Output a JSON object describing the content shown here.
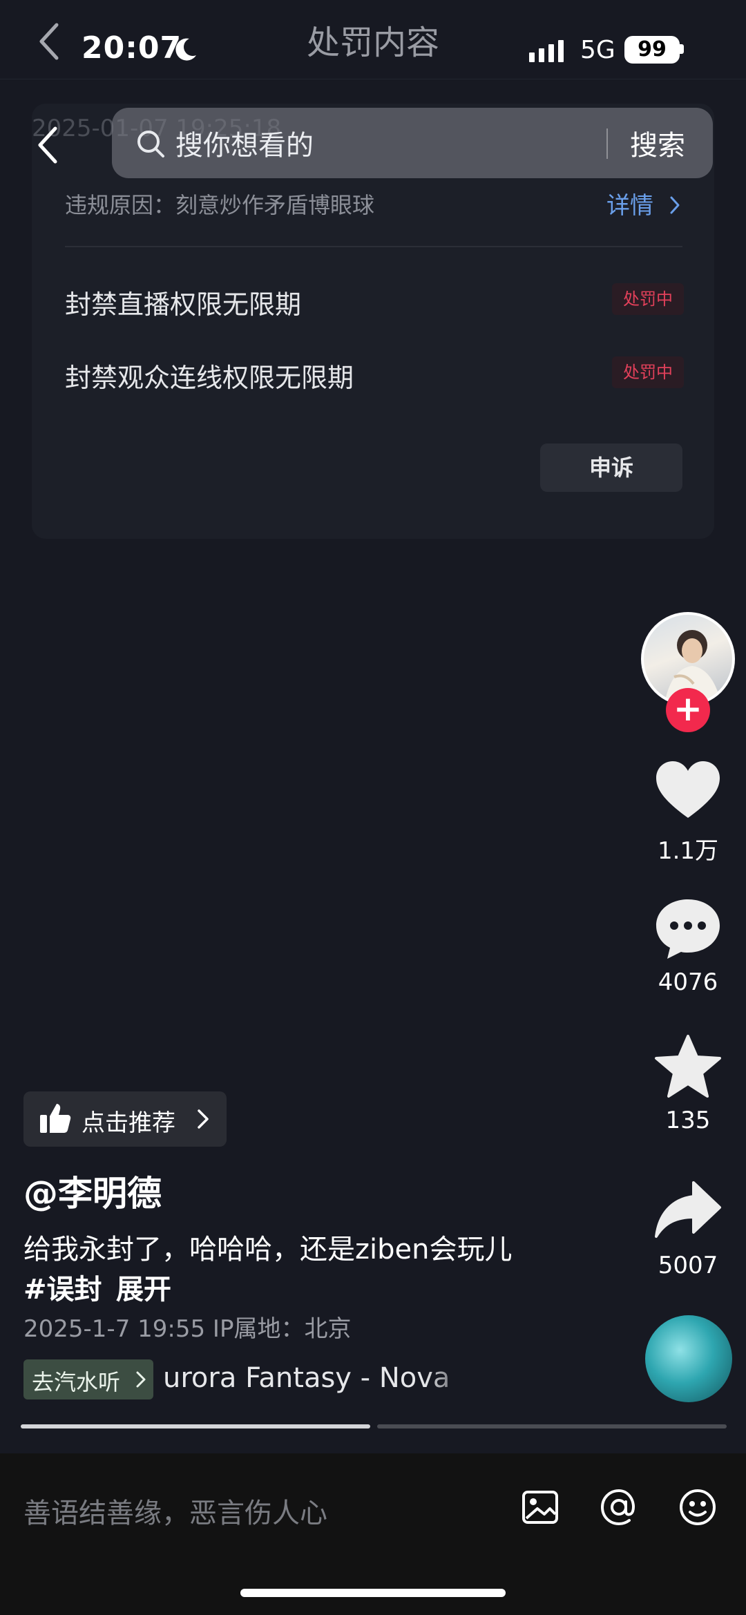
{
  "status": {
    "time": "20:07",
    "network": "5G",
    "battery": "99"
  },
  "header": {
    "title": "处罚内容"
  },
  "card": {
    "date": "2025-01-07 19:25:18",
    "reason": "违规原因：刻意炒作矛盾博眼球",
    "detail_label": "详情",
    "penalties": [
      {
        "label": "封禁直播权限无限期",
        "status": "处罚中"
      },
      {
        "label": "封禁观众连线权限无限期",
        "status": "处罚中"
      }
    ],
    "appeal_label": "申诉"
  },
  "search": {
    "placeholder": "搜你想看的",
    "button": "搜索"
  },
  "rail": {
    "likes": "1.1万",
    "comments": "4076",
    "favorites": "135",
    "shares": "5007"
  },
  "video": {
    "recommend_label": "点击推荐",
    "author": "@李明德",
    "caption": "给我永封了，哈哈哈，还是ziben会玩儿",
    "hashtag": "#误封",
    "expand": "展开",
    "meta": "2025-1-7 19:55  IP属地：北京",
    "soda_label": "去汽水听",
    "music": "urora   Fantasy - Nova"
  },
  "comment": {
    "placeholder": "善语结善缘，恶言伤人心"
  },
  "colors": {
    "accent_red": "#f2294d",
    "link_blue": "#6a9fea",
    "badge_red": "#e2405a",
    "background": "#171922"
  },
  "icons": [
    "back-icon",
    "moon-icon",
    "signal-icon",
    "search-icon",
    "chevron-right-icon",
    "heart-icon",
    "comment-icon",
    "star-icon",
    "share-icon",
    "thumbs-up-icon",
    "image-icon",
    "at-icon",
    "emoji-icon"
  ]
}
